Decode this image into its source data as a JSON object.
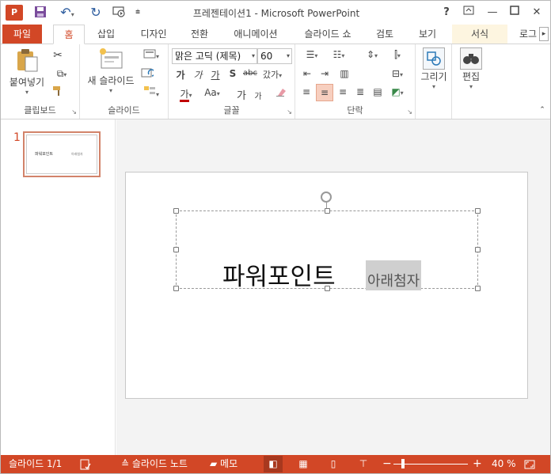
{
  "titlebar": {
    "app_icon_text": "P",
    "title": "프레젠테이션1 - Microsoft PowerPoint",
    "qat": {
      "save_icon": "💾",
      "undo_icon": "↶",
      "redo_icon": "↺",
      "present_icon": "▣",
      "customize_icon": "="
    },
    "help": "?",
    "restore_ribbon": "⊡",
    "minimize": "—",
    "maximize": "☐",
    "close": "✕"
  },
  "tabs": [
    "파일",
    "홈",
    "삽입",
    "디자인",
    "전환",
    "애니메이션",
    "슬라이드 쇼",
    "검토",
    "보기",
    "서식",
    "로그"
  ],
  "tab_scroll": "▸",
  "ribbon": {
    "clipboard": {
      "label": "클립보드",
      "paste": "붙여넣기",
      "cut_icon": "✂",
      "copy_icon": "⧉",
      "painter_icon": "🖌"
    },
    "slides": {
      "label": "슬라이드",
      "new_slide": "새 슬라이드"
    },
    "font": {
      "label": "글꼴",
      "font_name": "맑은 고딕 (제목)",
      "font_size": "60",
      "bold": "가",
      "italic": "가",
      "underline": "가",
      "shadow": "S",
      "strike": "abc",
      "spacing": "갔가",
      "color": "가",
      "case": "Aa",
      "grow": "가",
      "shrink": "가"
    },
    "paragraph": {
      "label": "단락"
    },
    "drawing": {
      "label": "그리기"
    },
    "editing": {
      "label": "편집"
    }
  },
  "thumbs": {
    "slide_number": "1",
    "title": "파워포인트",
    "subtitle": "아래첨자"
  },
  "slide": {
    "title": "파워포인트",
    "subtitle": "아래첨자"
  },
  "status": {
    "slide_info": "슬라이드 1/1",
    "notes": "슬라이드 노트",
    "comments": "메모",
    "zoom_minus": "−",
    "zoom_plus": "+",
    "zoom_percent": "40 %",
    "zoom_level": 0.4
  },
  "colors": {
    "accent": "#d24726"
  }
}
